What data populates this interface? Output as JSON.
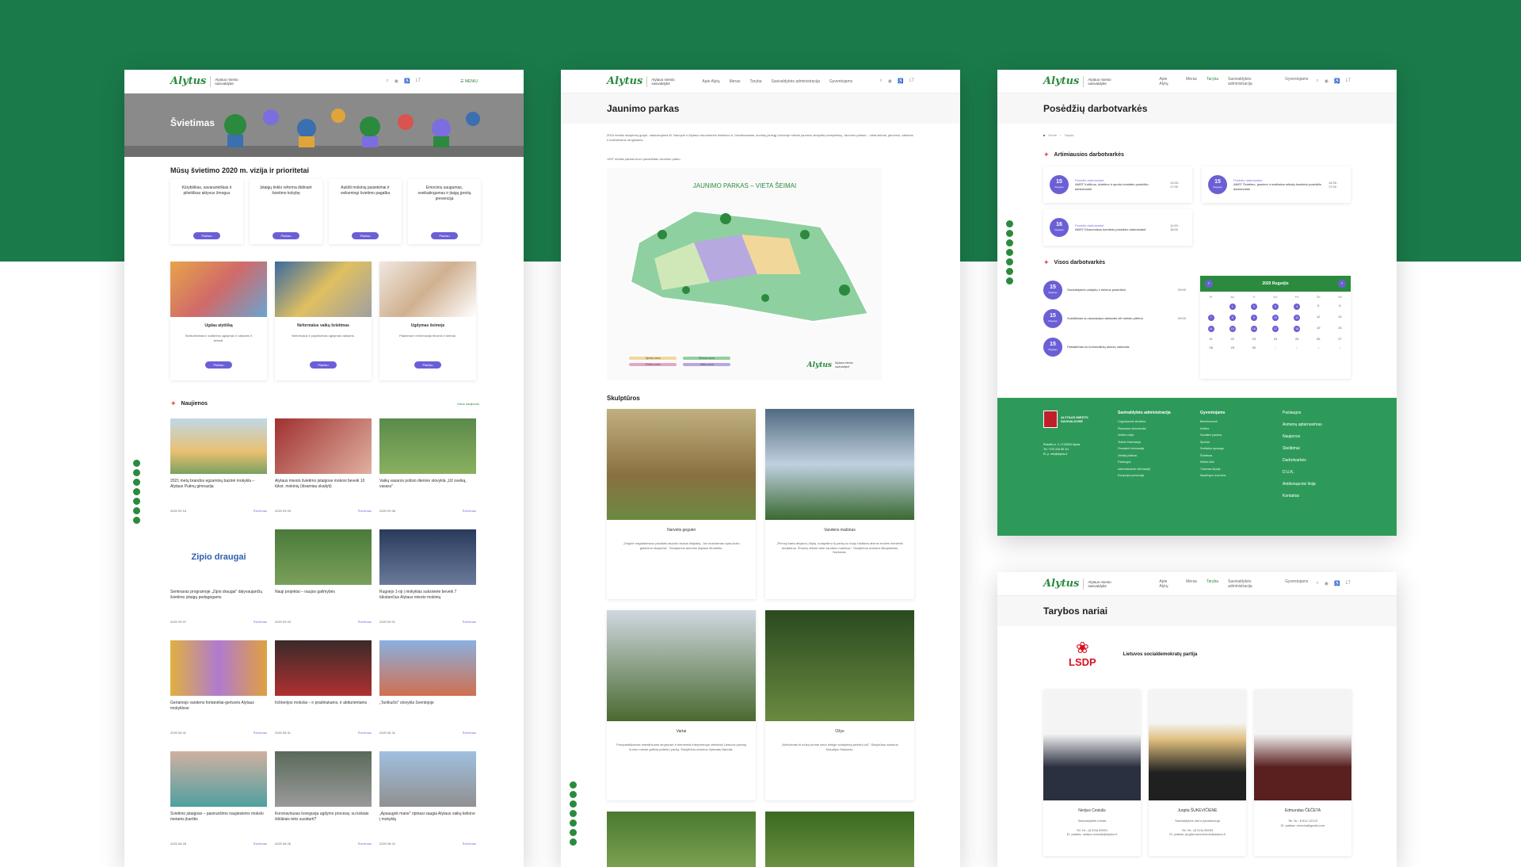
{
  "colors": {
    "brand_green": "#1a7a4a",
    "accent_purple": "#6b5fd6",
    "lsdp_red": "#d6121f"
  },
  "header": {
    "logo_text": "Alytus",
    "logo_sub": "Alytaus miesto savivaldybė",
    "menu": "MENIU",
    "lang": "LT",
    "nav": [
      "Apie Alytų",
      "Meras",
      "Taryba",
      "Savivaldybės administracija",
      "Gyventojams"
    ]
  },
  "p1": {
    "hero_title": "Švietimas",
    "vision_title": "Mūsų švietimo 2020 m. vizija ir prioritetai",
    "priorities": [
      "Kūrybiškas, savarankiškas ir pilietiškas aktyvus žmogus",
      "Įstaigų tinklo reforma didinant švietimo kokybę",
      "Aukšti mokinių pasiekimai ir veiksmingi švietimo pagalba",
      "Emociniu saugumas, sveikatingumas ir įtaigų įprotių prevencija"
    ],
    "more": "Plačiau",
    "cards": [
      {
        "title": "Ugdau alytišką",
        "text": "Sveikatinimas ir kultūrinis ugdymas ir vaikams ir šeimai."
      },
      {
        "title": "Neformalus vaikų švietimas",
        "text": "Neformalus ir papildomas ugdymas vaikams."
      },
      {
        "title": "Ugdymas šeimoje",
        "text": "Patarimai ir informacija tėvams ir šeimai."
      }
    ],
    "news_title": "Naujienos",
    "view_all": "Visos naujienos",
    "news": [
      {
        "title": "2021 metų brandos egzaminų bazinė mokykla – Alytaus Putinų gimnazija",
        "date": "2020 09 16",
        "tag": "Švietimas"
      },
      {
        "title": "Alytaus miesto švietimo įstaigose mokosi beveik 10 tūkst. mokinių (išsamiau skaityti)",
        "date": "2020 09 09",
        "tag": "Švietimas"
      },
      {
        "title": "Vaikų vasaros poilsio dienine stovykla „Už sveiką, vasara\"",
        "date": "2020 09 08",
        "tag": "Švietimas"
      },
      {
        "title": "Seminaras programoje „Zipio draugai\" dalyvaujančių švietimo įstaigų pedagogams",
        "date": "2020 09 07",
        "tag": "Švietimas"
      },
      {
        "title": "Nauji projektai – naujos galimybės",
        "date": "2020 09 03",
        "tag": "Švietimas"
      },
      {
        "title": "Rugsėjo 1-oji į mokyklas suksiviete beveik 7 tūkstančius Alytaus miesto mokinių",
        "date": "2020 09 01",
        "tag": "Švietimas"
      },
      {
        "title": "Geriamojo vandens fontanėliai-gertuvės Alytaus mokyklose",
        "date": "2020 08 31",
        "tag": "Švietimas"
      },
      {
        "title": "Inžinerijos mokslai – ir pradinukams, ir abiturientams",
        "date": "2020 08 31",
        "tag": "Švietimas"
      },
      {
        "title": "„Tarškučio\" stovykla Šventojoje",
        "date": "2020 08 31",
        "tag": "Švietimas"
      },
      {
        "title": "Švietimo įstaigose – pasiruošimo naujiesiems mokslo metams įkarštis",
        "date": "2020 08 28",
        "tag": "Švietimas"
      },
      {
        "title": "Koronavirusas koreguoja ugdymo procesą: su kokiais iššūkiais teks susidurti?",
        "date": "2020 08 26",
        "tag": "Švietimas"
      },
      {
        "title": "„Apsaugok mane\" ripinasi saugia Alytaus vaikų kelione į mokyklą",
        "date": "2020 08 24",
        "tag": "Švietimas"
      }
    ],
    "zipio_text": "Zipio draugai"
  },
  "p2": {
    "title": "Jaunimo parkas",
    "intro": "2004 metais skulptorių grupė, vadovaujama M. Narvydo ir Alytaus visuomenės išrinkimo A. Dambrauskas, surinkę pirmąjį Lietuvoje miesto jaunimo skulptūrų kompleksą. Jaunimo parkas – vieta šeimai, jaunimui, vaikams ir kultūriniams renginiams.",
    "intro2": "1997 metais parkas buvo pavadintas Jaunimo parku.",
    "map_title": "JAUNIMO PARKAS – VIETA ŠEIMAI",
    "legend": [
      "Sporto zona",
      "Šeimos zona",
      "Poilsio zona",
      "Vaikų zona"
    ],
    "sculpt_title": "Skulptūros",
    "sculptures": [
      {
        "name": "Narvelis gegutei",
        "text": "„Gegutė negalanmauo paukštis tarpušu laukus kitąlaikę. Jos kraunamas rąstų buku gebinimo skulptūra\". Skulptorius autorius Alytaus Mundėlis."
      },
      {
        "name": "Vandens malūnas",
        "text": "„Pirmoji karta atvykus į Alytų, sutapatinu šį parką su tuoju rūsiškos atviros erdvės miestelio skulptūros. Žmonių tėkmė tarsi vandens malūnas.\" Skulptūros autorius Benjaminas Narbutas."
      },
      {
        "name": "Vartai",
        "text": "Pompastiškumas metaliniuose strypuose ir elementai interpretuoja vienintelį Lietuvos portalą kuriuo mieste galima patekti į parką. Skulptūros autorius Vytautas Nanulis."
      },
      {
        "name": "Ožys",
        "text": "„Kiekvienas iš mūsų turime savo širdyje sustiprintą priekinį ožį\". Skulptūros autorius Klaudijus Stasiunis."
      }
    ]
  },
  "p3": {
    "title": "Posėdžių darbotvarkės",
    "breadcrumb": [
      "Home",
      "Taryba"
    ],
    "nearest_title": "Artimiausios darbotvarkės",
    "nearest": [
      {
        "day": "15",
        "month": "Rugsėjo",
        "cat": "Posėdis darbotvarkė",
        "text": "AMST Kultūros, švietimo ir sporto komiteto posėdžio darbotvarkė",
        "time": "12:00 - 17:00"
      },
      {
        "day": "15",
        "month": "Rugsėjo",
        "cat": "Posėdis darbotvarkė",
        "text": "AMST Švietimo, jaunimo ir sveikatos reikalų komiteto posėdžio darbotvarkė",
        "time": "14:00 - 17:00"
      },
      {
        "day": "16",
        "month": "Rugsėjo",
        "cat": "Posėdis darbotvarkė",
        "text": "AMST Ekonomikos komiteto posėdžio darbotvarkė",
        "time": "11:00 - 18:00"
      }
    ],
    "all_title": "Visos darbotvarkės",
    "all": [
      {
        "day": "15",
        "month": "Rugsėjo",
        "text": "Savivaldybės valdybų ir šeimos posėdžiai",
        "time": "09:00"
      },
      {
        "day": "15",
        "month": "Rugsėjo",
        "text": "Susitikimas su asociacijos atstovais dėl miesto plėtros",
        "time": "09:00"
      },
      {
        "day": "15",
        "month": "Rugsėjo",
        "text": "Pasitarimas su komunalinių įmonių vadovais",
        "time": ""
      }
    ],
    "cal_title": "2020 Rugsėjis",
    "weekdays": [
      "Pr",
      "An",
      "Tr",
      "Ke",
      "Pe",
      "Še",
      "Se"
    ],
    "days": [
      "",
      "1",
      "2",
      "3",
      "4",
      "5",
      "6",
      "7",
      "8",
      "9",
      "10",
      "11",
      "12",
      "13",
      "14",
      "15",
      "16",
      "17",
      "18",
      "19",
      "20",
      "21",
      "22",
      "23",
      "24",
      "25",
      "26",
      "27",
      "28",
      "29",
      "30",
      "1",
      "2",
      "3",
      "4"
    ],
    "footer": {
      "org": "ALYTAUS MIESTO SAVIVALDYBĖ",
      "address": "Rotušės a. 4, LT-62504 Alytus\nTel. +370 315 55 111\nEl. p. info@alytus.lt",
      "cols": [
        {
          "title": "Savivaldybės administracija",
          "items": [
            "Organizacinė struktūra",
            "Planavimo dokumentai",
            "Veiklos sritys",
            "Teisinė informacija",
            "Finansinė informacija",
            "Viešieji pirkimai",
            "Paslaugos",
            "Administracinė informacija",
            "Korupcijos prevencija"
          ]
        },
        {
          "title": "Gyventojams",
          "items": [
            "Bendruomenė",
            "Kultūra",
            "Socialinė parama",
            "Sportas",
            "Sveikatos apsauga",
            "Švietimas",
            "Miesto ūkis",
            "Turizmas Alytuje",
            "Naudingos nuorodos"
          ]
        },
        {
          "title": "",
          "items": [
            "Paslaugos",
            "Asmenų aptarnavimas",
            "Naujienos",
            "Skelbimai",
            "Darbotvarkės",
            "D.U.K.",
            "Antikorupcinė linija",
            "Kontaktai"
          ]
        }
      ]
    }
  },
  "p4": {
    "title": "Tarybos nariai",
    "party": "Lietuvos socialdemokratų partija",
    "party_logo": "LSDP",
    "members": [
      {
        "name": "Nerijus Cesiulis",
        "role": "Savivaldybės meras",
        "phone": "Tel. Nr.: (8 315) 55001",
        "email": "El. paštas: nerijus.cesiulis@alytus.lt"
      },
      {
        "name": "Jurgita ŠUKEVIČIENĖ",
        "role": "Savivaldybės mero pavaduotoja",
        "phone": "Tel. Nr.: (8 315) 55003",
        "email": "El. paštas: jurgita.sukeviciene@alytus.lt"
      },
      {
        "name": "Edmundas ČEČETA",
        "role": "",
        "phone": "Tel. Nr.: 8 614 12223",
        "email": "El. paštas: cerecta@gmail.com"
      }
    ]
  }
}
